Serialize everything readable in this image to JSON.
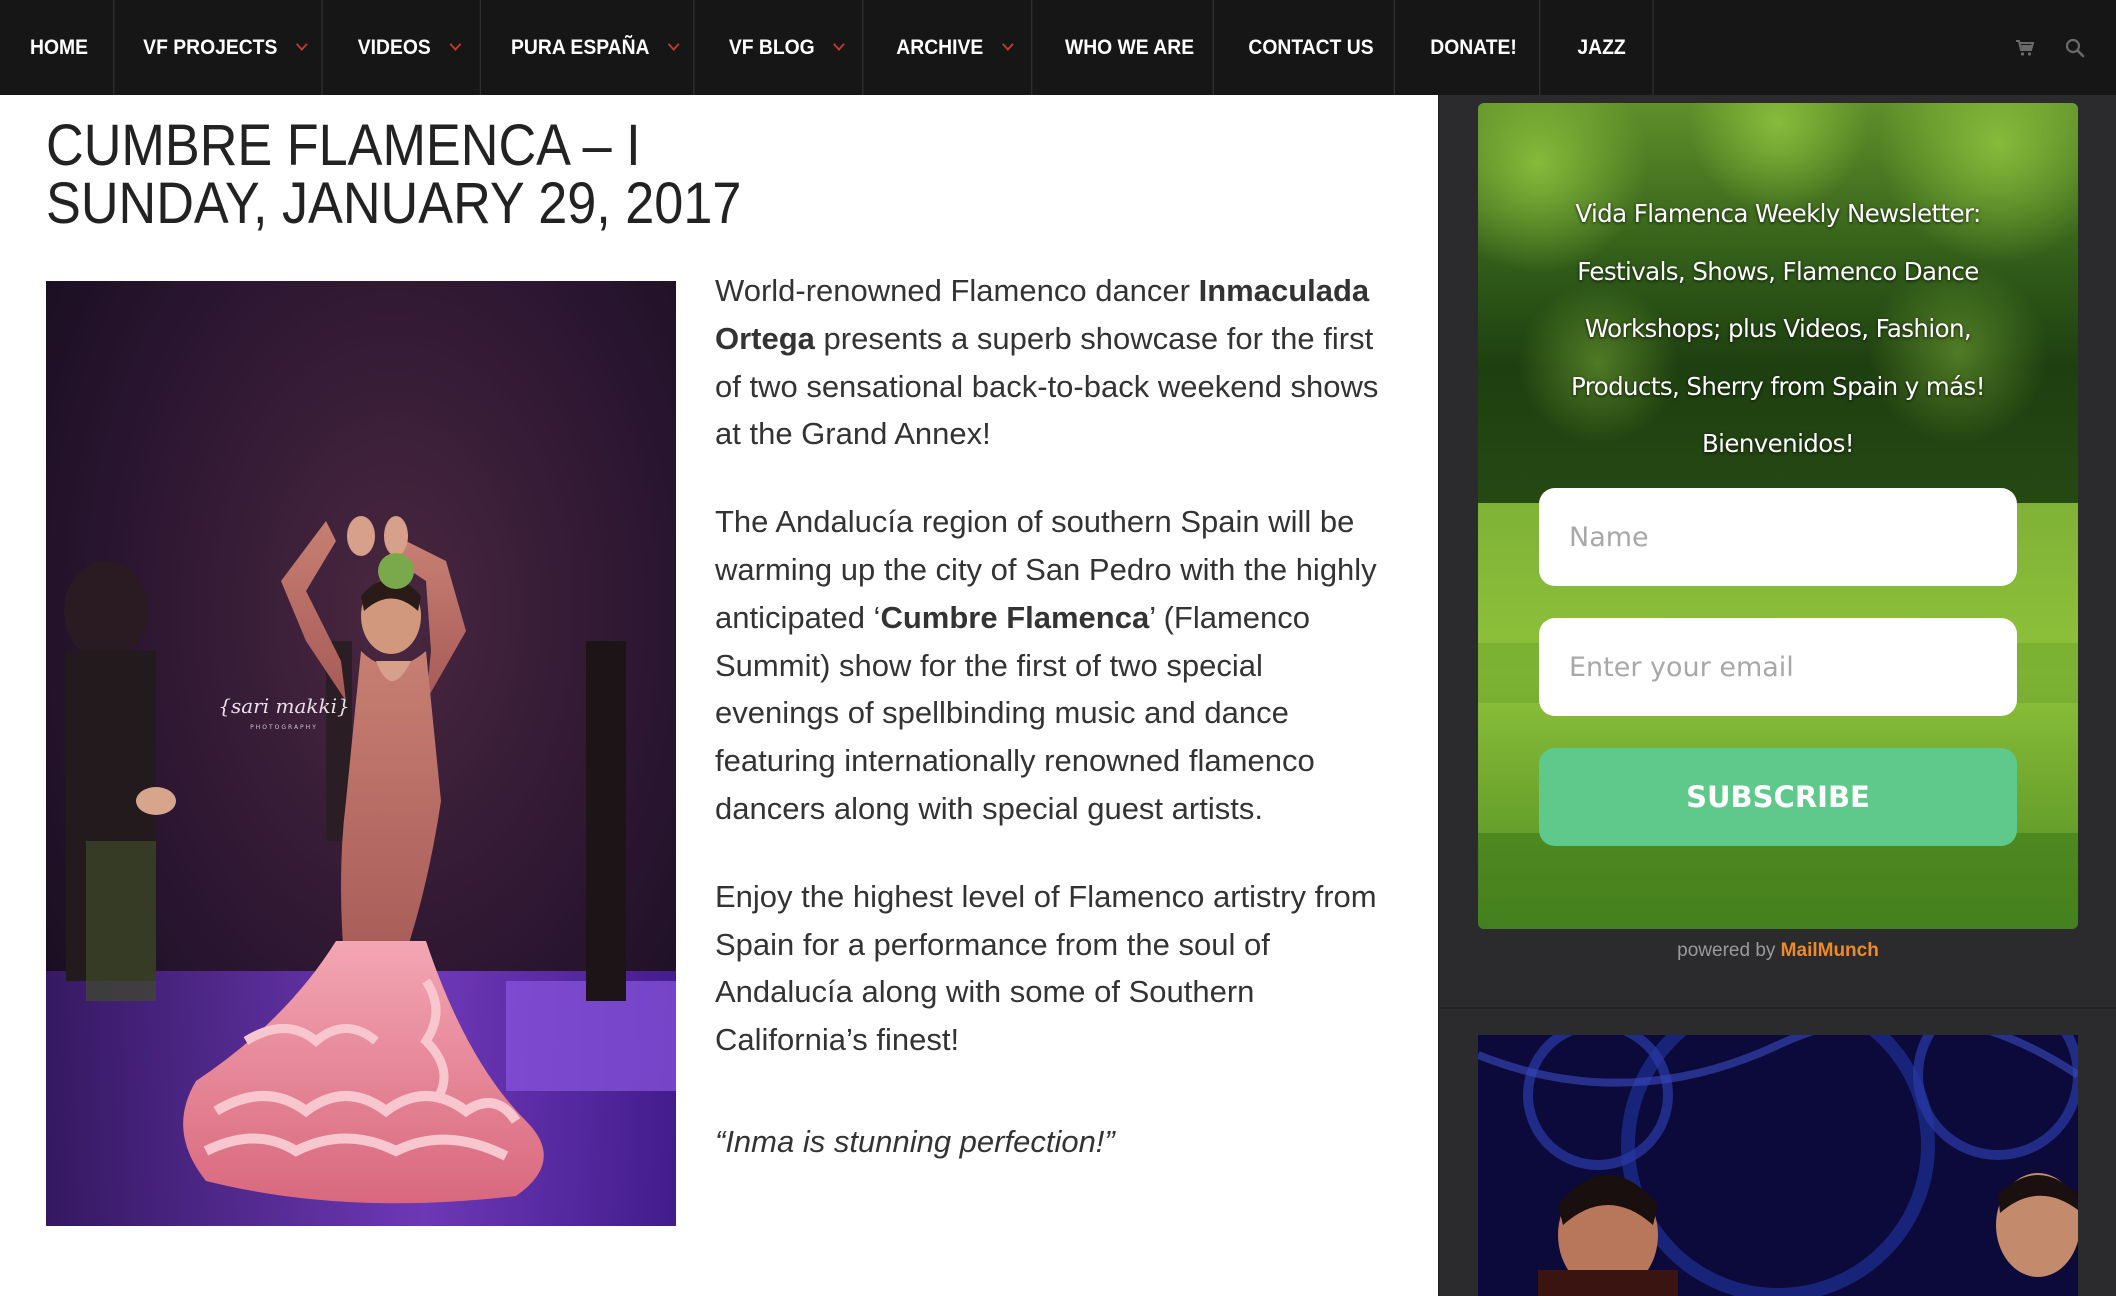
{
  "nav": {
    "items": [
      {
        "label": "HOME",
        "dropdown": false
      },
      {
        "label": "VF PROJECTS",
        "dropdown": true
      },
      {
        "label": "VIDEOS",
        "dropdown": true
      },
      {
        "label": "PURA ESPAÑA",
        "dropdown": true
      },
      {
        "label": "VF BLOG",
        "dropdown": true
      },
      {
        "label": "ARCHIVE",
        "dropdown": true
      },
      {
        "label": "WHO WE ARE",
        "dropdown": false
      },
      {
        "label": "CONTACT US",
        "dropdown": false
      },
      {
        "label": "DONATE!",
        "dropdown": false
      },
      {
        "label": "JAZZ",
        "dropdown": false
      }
    ],
    "icons": [
      "cart-icon",
      "search-icon"
    ]
  },
  "article": {
    "title_line1": "CUMBRE FLAMENCA – I",
    "title_line2": "SUNDAY, JANUARY 29, 2017",
    "photo_watermark": "{sari makki}",
    "photo_watermark_sub": "PHOTOGRAPHY",
    "p1_a": "World-renowned Flamenco dancer ",
    "p1_b": "Inmaculada Ortega",
    "p1_c": " presents a superb showcase for the first of two sensational back-to-back weekend shows at the Grand Annex!",
    "p2_a": "The Andalucía region of southern Spain will be warming up the city of San Pedro with the highly anticipated ‘",
    "p2_b": "Cumbre Flamenca",
    "p2_c": "’ (Flamenco Summit) show for the first of two special evenings of spellbinding music and dance featuring internationally renowned flamenco dancers along with special guest artists.",
    "p3": "Enjoy the highest level of Flamenco artistry from Spain for a performance from the soul of Andalucía along with some of Southern California’s finest!",
    "quote": "“Inma is stunning perfection!”"
  },
  "sidebar": {
    "newsletter": {
      "line1": "Vida Flamenca Weekly Newsletter:",
      "line2": "Festivals, Shows, Flamenco Dance",
      "line3": "Workshops; plus Videos, Fashion,",
      "line4": "Products, Sherry from Spain y más!",
      "line5": "Bienvenidos!",
      "name_placeholder": "Name",
      "email_placeholder": "Enter your email",
      "submit_label": "SUBSCRIBE"
    },
    "powered_by": "powered by ",
    "powered_brand": "MailMunch"
  },
  "colors": {
    "nav_bg": "#161616",
    "sidebar_bg": "#2b2b2d",
    "subscribe_green": "#5ec98b",
    "mailmunch_orange": "#f08a24",
    "chevron_red": "#c0392b"
  }
}
